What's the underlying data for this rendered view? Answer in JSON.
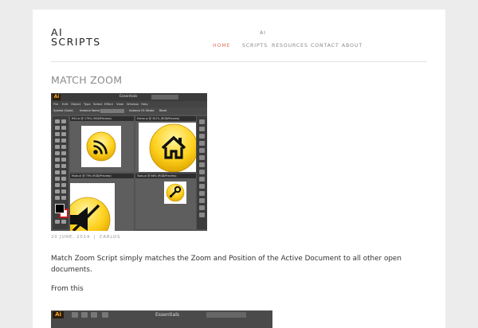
{
  "site": {
    "logo_line1": "AI",
    "logo_line2": "SCRIPTS"
  },
  "nav": {
    "items": [
      {
        "label": "HOME",
        "active": true
      },
      {
        "label": "AI",
        "label2": "SCRIPTS"
      },
      {
        "label": "RESOURCES"
      },
      {
        "label": "CONTACT"
      },
      {
        "label": "ABOUT"
      }
    ]
  },
  "post": {
    "title": "MATCH ZOOM",
    "date": "20 JUNE, 2014",
    "separator": "|",
    "author": "CARLOS",
    "body": "Match Zoom Script simply matches the Zoom and Position of the Active Document to all other open documents.",
    "from_this": "From this"
  },
  "screenshot1": {
    "app_badge": "Ai",
    "workspace": "Essentials",
    "menus": [
      "File",
      "Edit",
      "Object",
      "Type",
      "Select",
      "Effect",
      "View",
      "Window",
      "Help"
    ],
    "control_bar": {
      "left_label": "Symbol (Scale)",
      "instance_label": "Instance Name:",
      "edit_label": "Instance Of: Stroke",
      "reset_label": "Reset"
    },
    "doc_tabs": [
      "RSS.ai @ 179% (RGB/Preview)",
      "Home.ai @ 301% (RGB/Preview)",
      "Mute.ai @ 79% (RGB/Preview)",
      "Tools.ai @ 66% (RGB/Preview)"
    ],
    "icons": [
      "rss-icon",
      "home-icon",
      "mute-icon",
      "wrench-icon"
    ],
    "colors": {
      "icon_yellow": "#ffd21f",
      "icon_yellow_dark": "#e0a800",
      "ui_dark": "#535353"
    }
  },
  "screenshot2": {
    "app_badge": "Ai",
    "workspace": "Essentials"
  },
  "colors": {
    "accent": "#e0725f",
    "page_bg": "#ececec",
    "card_bg": "#ffffff"
  }
}
